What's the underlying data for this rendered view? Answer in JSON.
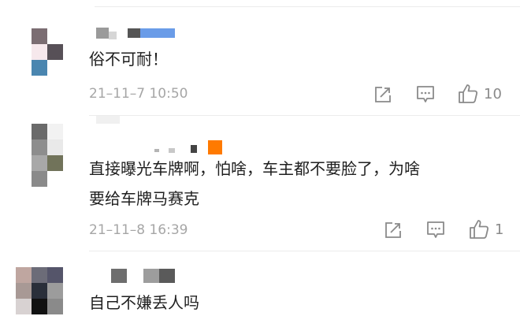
{
  "comments": [
    {
      "text": "俗不可耐！",
      "time": "21–11–7 10:50",
      "likes": "10"
    },
    {
      "text_lines": [
        "直接曝光车牌啊，怕啥，车主都不要脸了，为啥",
        "要给车牌马赛克"
      ],
      "time": "21–11–8 16:39",
      "likes": "1"
    },
    {
      "text": "自己不嫌丢人吗"
    }
  ],
  "icons": {
    "share": "share-icon",
    "reply": "comment-icon",
    "like": "thumb-up-icon"
  },
  "colors": {
    "text": "#1f1f1f",
    "meta": "#a6a6a6",
    "icon": "#8a8a8a",
    "accent": "#ff7a00"
  }
}
